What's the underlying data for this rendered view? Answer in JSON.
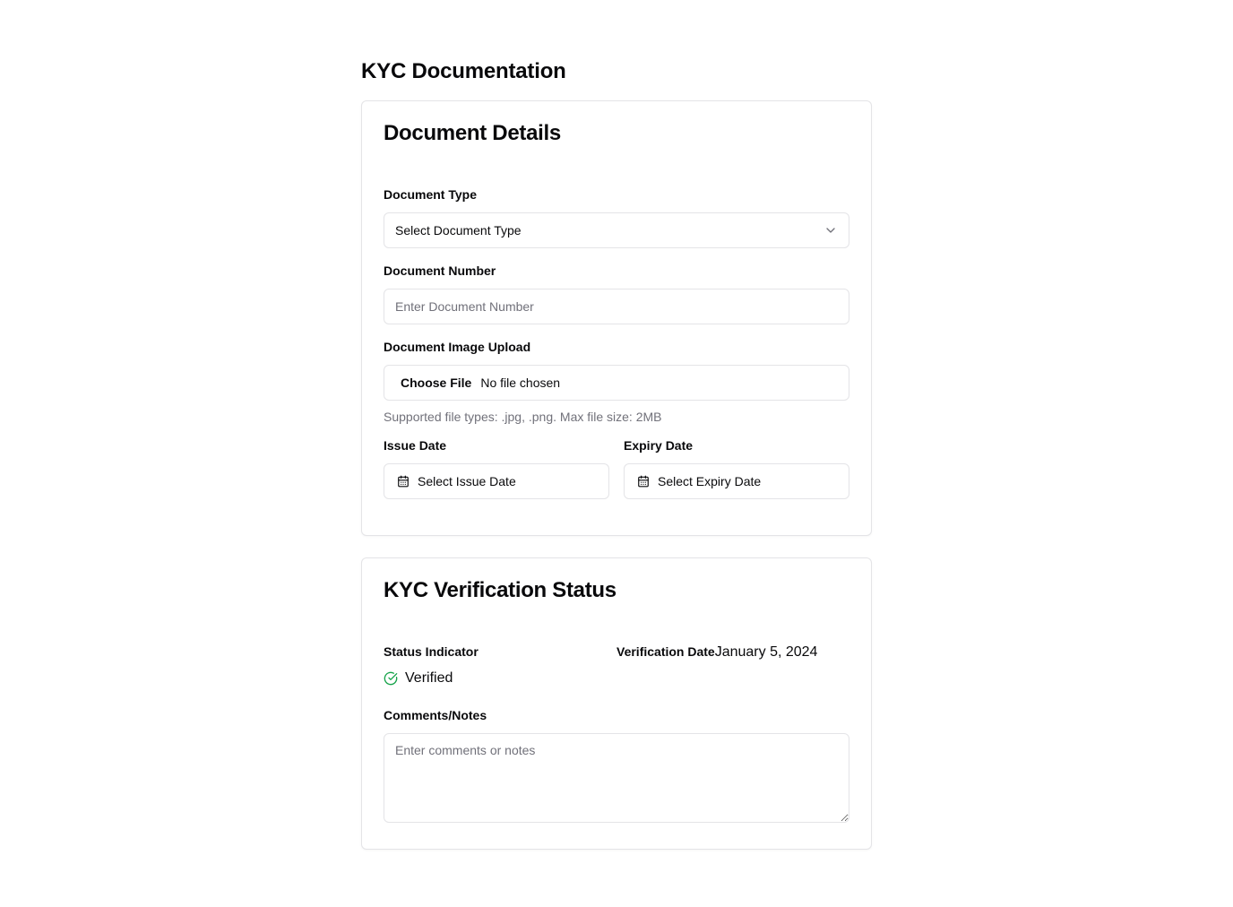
{
  "page": {
    "title": "KYC Documentation"
  },
  "document_details": {
    "title": "Document Details",
    "document_type": {
      "label": "Document Type",
      "selected": "Select Document Type",
      "icon": "chevron-down-icon"
    },
    "document_number": {
      "label": "Document Number",
      "placeholder": "Enter Document Number",
      "value": ""
    },
    "document_image": {
      "label": "Document Image Upload",
      "button_label": "Choose File",
      "file_status": "No file chosen",
      "helper": "Supported file types: .jpg, .png. Max file size: 2MB"
    },
    "issue_date": {
      "label": "Issue Date",
      "placeholder": "Select Issue Date",
      "icon": "calendar-icon"
    },
    "expiry_date": {
      "label": "Expiry Date",
      "placeholder": "Select Expiry Date",
      "icon": "calendar-icon"
    }
  },
  "verification_status": {
    "title": "KYC Verification Status",
    "status_indicator": {
      "label": "Status Indicator",
      "value": "Verified",
      "icon": "check-circle-icon",
      "color": "#16a34a"
    },
    "verification_date": {
      "label": "Verification Date",
      "value": "January 5, 2024"
    },
    "comments": {
      "label": "Comments/Notes",
      "placeholder": "Enter comments or notes",
      "value": ""
    }
  }
}
